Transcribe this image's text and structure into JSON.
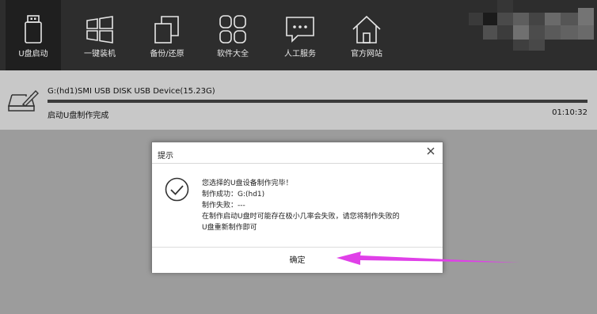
{
  "toolbar": {
    "items": [
      {
        "label": "U盘启动",
        "icon": "usb-drive-icon",
        "active": true
      },
      {
        "label": "一键装机",
        "icon": "windows-icon",
        "active": false
      },
      {
        "label": "备份/还原",
        "icon": "copy-icon",
        "active": false
      },
      {
        "label": "软件大全",
        "icon": "apps-grid-icon",
        "active": false
      },
      {
        "label": "人工服务",
        "icon": "chat-icon",
        "active": false
      },
      {
        "label": "官方网站",
        "icon": "home-icon",
        "active": false
      }
    ]
  },
  "device": {
    "name": "G:(hd1)SMI USB DISK USB Device(15.23G)",
    "progress": 1.0,
    "status": "启动U盘制作完成",
    "elapsed": "01:10:32"
  },
  "dialog": {
    "title": "提示",
    "lines": [
      "您选择的U盘设备制作完毕！",
      "制作成功：G:(hd1)",
      "制作失败：---",
      "在制作启动U盘时可能存在极小几率会失败，请您将制作失败的",
      "U盘重新制作即可"
    ],
    "ok_label": "确定"
  },
  "colors": {
    "toolbar_bg": "#2d2d2d",
    "panel_bg": "#c8c8c8",
    "page_bg": "#9c9c9c",
    "arrow": "#e040e8"
  }
}
